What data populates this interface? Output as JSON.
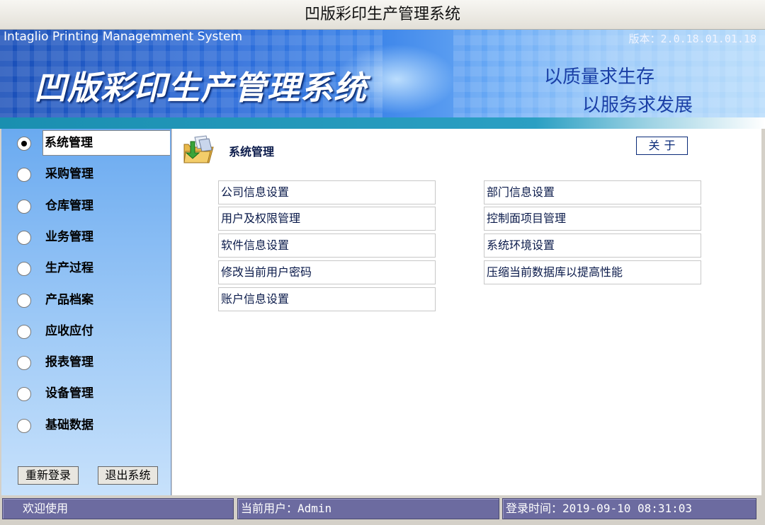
{
  "window": {
    "title": "凹版彩印生产管理系统"
  },
  "banner": {
    "subtitle_en": "Intaglio Printing Managemment System",
    "version": "版本：2.0.18.01.01.18",
    "title": "凹版彩印生产管理系统",
    "slogan_line1": "以质量求生存",
    "slogan_line2": "以服务求发展"
  },
  "sidebar": {
    "selected": "系统管理",
    "items": [
      {
        "label": "系统管理"
      },
      {
        "label": "采购管理"
      },
      {
        "label": "仓库管理"
      },
      {
        "label": "业务管理"
      },
      {
        "label": "生产过程"
      },
      {
        "label": "产品档案"
      },
      {
        "label": "应收应付"
      },
      {
        "label": "报表管理"
      },
      {
        "label": "设备管理"
      },
      {
        "label": "基础数据"
      }
    ],
    "relogin_label": "重新登录",
    "exit_label": "退出系统"
  },
  "main": {
    "section_title": "系统管理",
    "section_icon": "folder-icon",
    "about_label": "关于",
    "left_links": [
      "公司信息设置",
      "用户及权限管理",
      "软件信息设置",
      "修改当前用户密码",
      "账户信息设置"
    ],
    "right_links": [
      "部门信息设置",
      "控制面项目管理",
      "系统环境设置",
      "压缩当前数据库以提高性能"
    ]
  },
  "status": {
    "welcome": "欢迎使用",
    "user_label": "当前用户：",
    "user_value": "Admin",
    "login_label": "登录时间：",
    "login_value": "2019-09-10 08:31:03"
  },
  "colors": {
    "banner_blue": "#2a6ad8",
    "accent_teal": "#1a8fb0",
    "sidebar_blue": "#6aaaf0",
    "status_purple": "#6c6ba0",
    "link_text": "#0a1a4a"
  }
}
